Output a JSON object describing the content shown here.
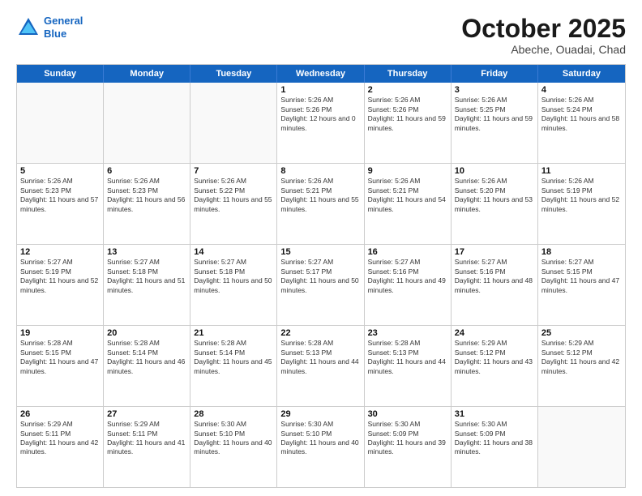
{
  "header": {
    "logo": {
      "line1": "General",
      "line2": "Blue"
    },
    "month": "October 2025",
    "location": "Abeche, Ouadai, Chad"
  },
  "days_of_week": [
    "Sunday",
    "Monday",
    "Tuesday",
    "Wednesday",
    "Thursday",
    "Friday",
    "Saturday"
  ],
  "weeks": [
    [
      {
        "day": "",
        "empty": true
      },
      {
        "day": "",
        "empty": true
      },
      {
        "day": "",
        "empty": true
      },
      {
        "day": "1",
        "sunrise": "5:26 AM",
        "sunset": "5:26 PM",
        "daylight": "12 hours and 0 minutes."
      },
      {
        "day": "2",
        "sunrise": "5:26 AM",
        "sunset": "5:26 PM",
        "daylight": "11 hours and 59 minutes."
      },
      {
        "day": "3",
        "sunrise": "5:26 AM",
        "sunset": "5:25 PM",
        "daylight": "11 hours and 59 minutes."
      },
      {
        "day": "4",
        "sunrise": "5:26 AM",
        "sunset": "5:24 PM",
        "daylight": "11 hours and 58 minutes."
      }
    ],
    [
      {
        "day": "5",
        "sunrise": "5:26 AM",
        "sunset": "5:23 PM",
        "daylight": "11 hours and 57 minutes."
      },
      {
        "day": "6",
        "sunrise": "5:26 AM",
        "sunset": "5:23 PM",
        "daylight": "11 hours and 56 minutes."
      },
      {
        "day": "7",
        "sunrise": "5:26 AM",
        "sunset": "5:22 PM",
        "daylight": "11 hours and 55 minutes."
      },
      {
        "day": "8",
        "sunrise": "5:26 AM",
        "sunset": "5:21 PM",
        "daylight": "11 hours and 55 minutes."
      },
      {
        "day": "9",
        "sunrise": "5:26 AM",
        "sunset": "5:21 PM",
        "daylight": "11 hours and 54 minutes."
      },
      {
        "day": "10",
        "sunrise": "5:26 AM",
        "sunset": "5:20 PM",
        "daylight": "11 hours and 53 minutes."
      },
      {
        "day": "11",
        "sunrise": "5:26 AM",
        "sunset": "5:19 PM",
        "daylight": "11 hours and 52 minutes."
      }
    ],
    [
      {
        "day": "12",
        "sunrise": "5:27 AM",
        "sunset": "5:19 PM",
        "daylight": "11 hours and 52 minutes."
      },
      {
        "day": "13",
        "sunrise": "5:27 AM",
        "sunset": "5:18 PM",
        "daylight": "11 hours and 51 minutes."
      },
      {
        "day": "14",
        "sunrise": "5:27 AM",
        "sunset": "5:18 PM",
        "daylight": "11 hours and 50 minutes."
      },
      {
        "day": "15",
        "sunrise": "5:27 AM",
        "sunset": "5:17 PM",
        "daylight": "11 hours and 50 minutes."
      },
      {
        "day": "16",
        "sunrise": "5:27 AM",
        "sunset": "5:16 PM",
        "daylight": "11 hours and 49 minutes."
      },
      {
        "day": "17",
        "sunrise": "5:27 AM",
        "sunset": "5:16 PM",
        "daylight": "11 hours and 48 minutes."
      },
      {
        "day": "18",
        "sunrise": "5:27 AM",
        "sunset": "5:15 PM",
        "daylight": "11 hours and 47 minutes."
      }
    ],
    [
      {
        "day": "19",
        "sunrise": "5:28 AM",
        "sunset": "5:15 PM",
        "daylight": "11 hours and 47 minutes."
      },
      {
        "day": "20",
        "sunrise": "5:28 AM",
        "sunset": "5:14 PM",
        "daylight": "11 hours and 46 minutes."
      },
      {
        "day": "21",
        "sunrise": "5:28 AM",
        "sunset": "5:14 PM",
        "daylight": "11 hours and 45 minutes."
      },
      {
        "day": "22",
        "sunrise": "5:28 AM",
        "sunset": "5:13 PM",
        "daylight": "11 hours and 44 minutes."
      },
      {
        "day": "23",
        "sunrise": "5:28 AM",
        "sunset": "5:13 PM",
        "daylight": "11 hours and 44 minutes."
      },
      {
        "day": "24",
        "sunrise": "5:29 AM",
        "sunset": "5:12 PM",
        "daylight": "11 hours and 43 minutes."
      },
      {
        "day": "25",
        "sunrise": "5:29 AM",
        "sunset": "5:12 PM",
        "daylight": "11 hours and 42 minutes."
      }
    ],
    [
      {
        "day": "26",
        "sunrise": "5:29 AM",
        "sunset": "5:11 PM",
        "daylight": "11 hours and 42 minutes."
      },
      {
        "day": "27",
        "sunrise": "5:29 AM",
        "sunset": "5:11 PM",
        "daylight": "11 hours and 41 minutes."
      },
      {
        "day": "28",
        "sunrise": "5:30 AM",
        "sunset": "5:10 PM",
        "daylight": "11 hours and 40 minutes."
      },
      {
        "day": "29",
        "sunrise": "5:30 AM",
        "sunset": "5:10 PM",
        "daylight": "11 hours and 40 minutes."
      },
      {
        "day": "30",
        "sunrise": "5:30 AM",
        "sunset": "5:09 PM",
        "daylight": "11 hours and 39 minutes."
      },
      {
        "day": "31",
        "sunrise": "5:30 AM",
        "sunset": "5:09 PM",
        "daylight": "11 hours and 38 minutes."
      },
      {
        "day": "",
        "empty": true
      }
    ]
  ]
}
